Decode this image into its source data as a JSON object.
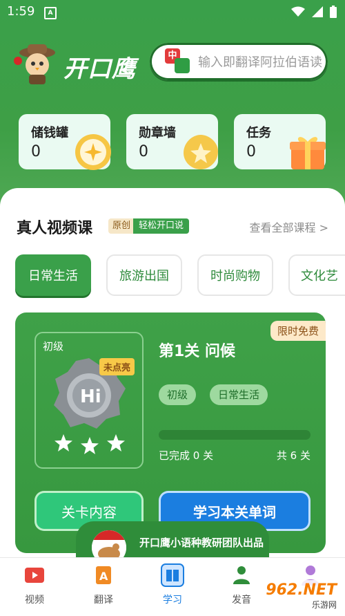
{
  "status": {
    "time": "1:59"
  },
  "brand": {
    "name": "开口鹰"
  },
  "search": {
    "placeholder": "输入即翻译阿拉伯语读",
    "icon_text": "中"
  },
  "stats": [
    {
      "label": "储钱罐",
      "value": "0"
    },
    {
      "label": "勋章墙",
      "value": "0"
    },
    {
      "label": "任务",
      "value": "0"
    }
  ],
  "section": {
    "title": "真人视频课",
    "tag_original": "原创",
    "tag_slogan": "轻松开口说",
    "see_all": "查看全部课程 >"
  },
  "categories": [
    "日常生活",
    "旅游出国",
    "时尚购物",
    "文化艺"
  ],
  "lesson": {
    "free_badge": "限时免费",
    "level_label": "初级",
    "unlit_label": "未点亮",
    "title": "第1关 问候",
    "tags": [
      "初级",
      "日常生活"
    ],
    "completed_text": "已完成 0 关",
    "total_text": "共 6 关",
    "progress": 0,
    "btn_content": "关卡内容",
    "btn_words": "学习本关单词"
  },
  "credit": {
    "text": "开口鹰小语种教研团队出品"
  },
  "nav": [
    {
      "label": "视频",
      "icon": "video-icon"
    },
    {
      "label": "翻译",
      "icon": "translate-icon"
    },
    {
      "label": "学习",
      "icon": "book-icon"
    },
    {
      "label": "发音",
      "icon": "speaker-icon"
    },
    {
      "label": "",
      "icon": "profile-icon"
    }
  ],
  "watermark": {
    "brand": "962.NET",
    "sub": "乐游网"
  },
  "colors": {
    "primary_green": "#3aa04a",
    "accent_blue": "#1b7ee0",
    "chip_text": "#2f8b3c"
  }
}
